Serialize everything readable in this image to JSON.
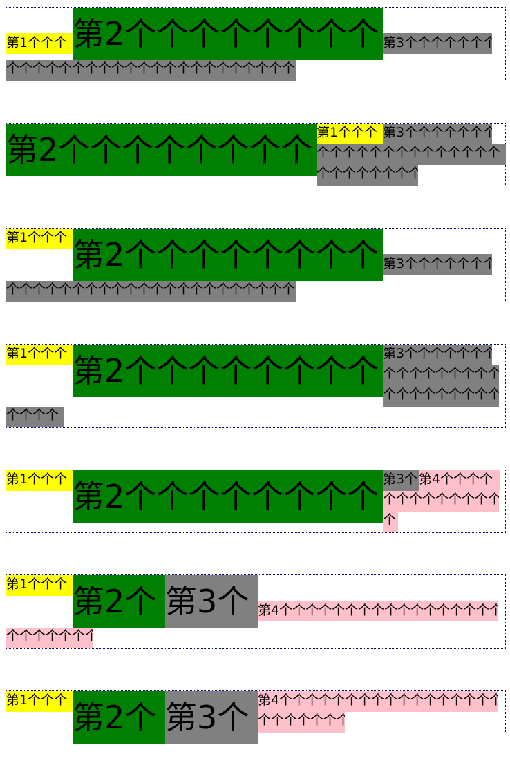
{
  "colors": {
    "seg1": "#ffff00",
    "seg2": "#008000",
    "seg3": "#808080",
    "seg4": "#ffc0cb",
    "border": "#000080"
  },
  "block1": {
    "seg1": "第1个个个",
    "seg2": "第2个个个个个个个个",
    "seg3_line1": "第3个个个个个个个",
    "seg3_line2": "个个个个个个个个个个个个个个个个个个个个个个个"
  },
  "block2": {
    "seg2": "第2个个个个个个个个",
    "seg1": "第1个个个",
    "seg3_line1": "第3个个个个个个个",
    "seg3_line2": "个个个个个个个个个个个个个个",
    "seg3_line3": "个个个个个个个个"
  },
  "block3": {
    "seg1": "第1个个个",
    "seg2": "第2个个个个个个个个",
    "seg3_line1": "第3个个个个个个个",
    "seg3_line2": "个个个个个个个个个个个个个个个个个个个个个个个"
  },
  "block4": {
    "seg1": "第1个个个",
    "seg2": "第2个个个个个个个个",
    "seg3_line1": "第3个个个个个个个",
    "seg3_line2": "个个个个个个个个个",
    "seg3_line3": "个个个个个个个个个",
    "seg3_line4": "个个个个"
  },
  "block5": {
    "seg1": "第1个个个",
    "seg2": "第2个个个个个个个个",
    "seg3": "第3个",
    "seg4_line1": "第4个个个个",
    "seg4_line2": "个个个个个个个个个",
    "seg4_line3": "个"
  },
  "block6": {
    "seg1": "第1个个个",
    "seg2": "第2个",
    "seg3": "第3个",
    "seg4_line1": "第4个个个个个个个个个个个个个个个个个个",
    "seg4_line2": "个个个个个个个"
  },
  "block7": {
    "seg1": "第1个个个",
    "seg2": "第2个",
    "seg3": "第3个",
    "seg4_line1": "第4个个个个个个个个个个个个个个个个个个",
    "seg4_line2": "个个个个个个个"
  }
}
